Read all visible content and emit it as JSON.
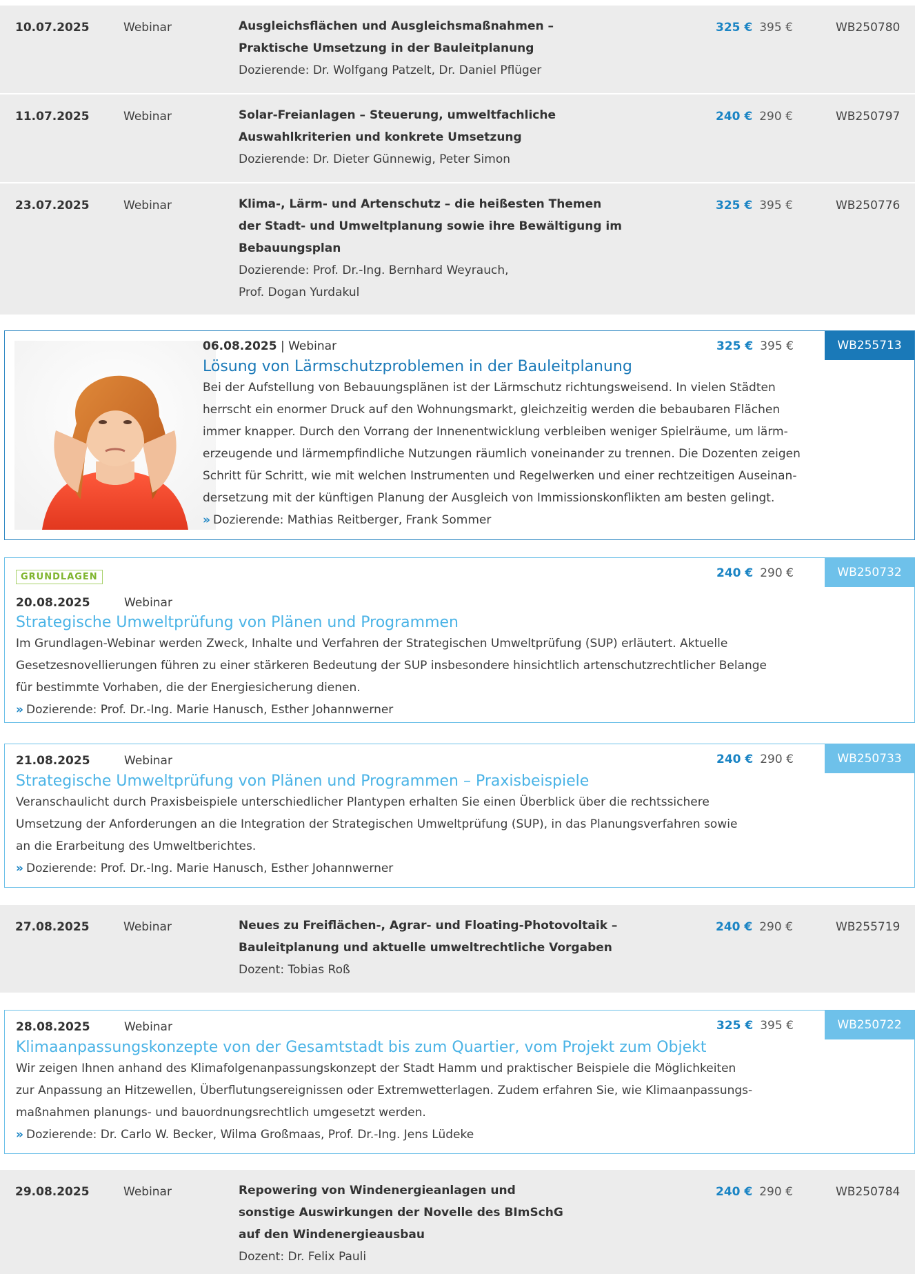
{
  "entries": [
    {
      "date": "10.07.2025",
      "type": "Webinar",
      "title": [
        "Ausgleichsflächen und Ausgleichsmaßnahmen –",
        "Praktische Umsetzung in der Bauleitplanung"
      ],
      "lecturers": [
        "Dozierende: Dr. Wolfgang Patzelt, Dr. Daniel Pflüger"
      ],
      "price": "325 €",
      "old_price": "395 €",
      "code": "WB250780"
    },
    {
      "date": "11.07.2025",
      "type": "Webinar",
      "title": [
        "Solar-Freianlagen – Steuerung, umweltfachliche",
        "Auswahlkriterien und konkrete Umsetzung"
      ],
      "lecturers": [
        "Dozierende: Dr. Dieter Günnewig, Peter Simon"
      ],
      "price": "240 €",
      "old_price": "290 €",
      "code": "WB250797"
    },
    {
      "date": "23.07.2025",
      "type": "Webinar",
      "title": [
        "Klima-, Lärm- und Artenschutz – die heißesten Themen",
        "der Stadt- und Umweltplanung sowie ihre Bewältigung im",
        "Bebauungsplan"
      ],
      "lecturers": [
        "Dozierende: Prof. Dr.-Ing. Bernhard Weyrauch,",
        "Prof. Dogan Yurdakul"
      ],
      "price": "325 €",
      "old_price": "395 €",
      "code": "WB250776"
    },
    {
      "date": "06.08.2025",
      "separator": "|",
      "type": "Webinar",
      "title": "Lösung von Lärmschutzproblemen in der Bauleitplanung",
      "desc": [
        "Bei der Aufstellung von Bebauungsplänen ist der Lärmschutz richtungsweisend. In vielen Städten",
        "herrscht ein enormer Druck auf den Wohnungsmarkt, gleichzeitig werden die bebaubaren Flächen",
        "immer knapper. Durch den Vorrang der Innenentwicklung verbleiben weniger Spielräume, um lärm-",
        "erzeugende und lärmempfindliche Nutzungen räumlich voneinander zu trennen. Die Dozenten zeigen",
        "Schritt für Schritt, wie mit welchen Instrumenten und Regelwerken und einer rechtzeitigen Auseinan-",
        "dersetzung mit der künftigen Planung der Ausgleich von Immissionskonflikten am besten gelingt."
      ],
      "lecturers": "Dozierende: Mathias Reitberger, Frank Sommer",
      "price": "325 €",
      "old_price": "395 €",
      "code": "WB255713"
    },
    {
      "badge": "GRUNDLAGEN",
      "date": "20.08.2025",
      "type": "Webinar",
      "title": "Strategische Umweltprüfung von Plänen und Programmen",
      "desc": [
        "Im Grundlagen-Webinar werden Zweck, Inhalte und Verfahren der Strategischen Umweltprüfung (SUP) erläutert. Aktuelle",
        "Gesetzesnovellierungen führen zu einer stärkeren Bedeutung der SUP insbesondere hinsichtlich artenschutzrechtlicher Belange",
        "für bestimmte Vorhaben, die der Energiesicherung dienen."
      ],
      "lecturers": "Dozierende: Prof. Dr.-Ing. Marie Hanusch, Esther Johannwerner",
      "price": "240 €",
      "old_price": "290 €",
      "code": "WB250732"
    },
    {
      "date": "21.08.2025",
      "type": "Webinar",
      "title": "Strategische Umweltprüfung von Plänen und Programmen – Praxisbeispiele",
      "desc": [
        "Veranschaulicht durch Praxisbeispiele unterschiedlicher Plantypen erhalten Sie einen Überblick über die rechtssichere",
        "Umsetzung der Anforderungen an die Integration der Strategischen Umweltprüfung (SUP), in das Planungsverfahren sowie",
        "an die Erarbeitung des Umweltberichtes."
      ],
      "lecturers": "Dozierende: Prof. Dr.-Ing. Marie Hanusch, Esther Johannwerner",
      "price": "240 €",
      "old_price": "290 €",
      "code": "WB250733"
    },
    {
      "date": "27.08.2025",
      "type": "Webinar",
      "title": [
        "Neues zu Freiflächen-, Agrar- und Floating-Photovoltaik –",
        "Bauleitplanung und aktuelle umweltrechtliche Vorgaben"
      ],
      "lecturers": [
        "Dozent: Tobias Roß"
      ],
      "price": "240 €",
      "old_price": "290 €",
      "code": "WB255719"
    },
    {
      "date": "28.08.2025",
      "type": "Webinar",
      "title": "Klimaanpassungskonzepte von der Gesamtstadt bis zum Quartier, vom Projekt zum Objekt",
      "desc": [
        "Wir zeigen Ihnen anhand des Klimafolgenanpassungskonzept der Stadt Hamm und praktischer Beispiele die Möglichkeiten",
        "zur Anpassung an Hitzewellen, Überflutungsereignissen oder Extremwetterlagen. Zudem erfahren Sie, wie Klimaanpassungs-",
        "maßnahmen planungs- und bauordnungsrechtlich umgesetzt werden."
      ],
      "lecturers": "Dozierende: Dr. Carlo W. Becker, Wilma Großmaas, Prof. Dr.-Ing. Jens Lüdeke",
      "price": "325 €",
      "old_price": "395 €",
      "code": "WB250722"
    },
    {
      "date": "29.08.2025",
      "type": "Webinar",
      "title": [
        "Repowering von Windenergieanlagen und",
        "sonstige Auswirkungen der Novelle des BImSchG",
        "auf den Windenergieausbau"
      ],
      "lecturers": [
        "Dozent: Dr. Felix Pauli"
      ],
      "price": "240 €",
      "old_price": "290 €",
      "code": "WB250784"
    }
  ],
  "icons": {
    "bullet": "»"
  },
  "colors": {
    "accent": "#1a79b8",
    "accent_light": "#6ec1ea",
    "badge_green": "#7fb52e",
    "row_grey": "#ececec"
  }
}
